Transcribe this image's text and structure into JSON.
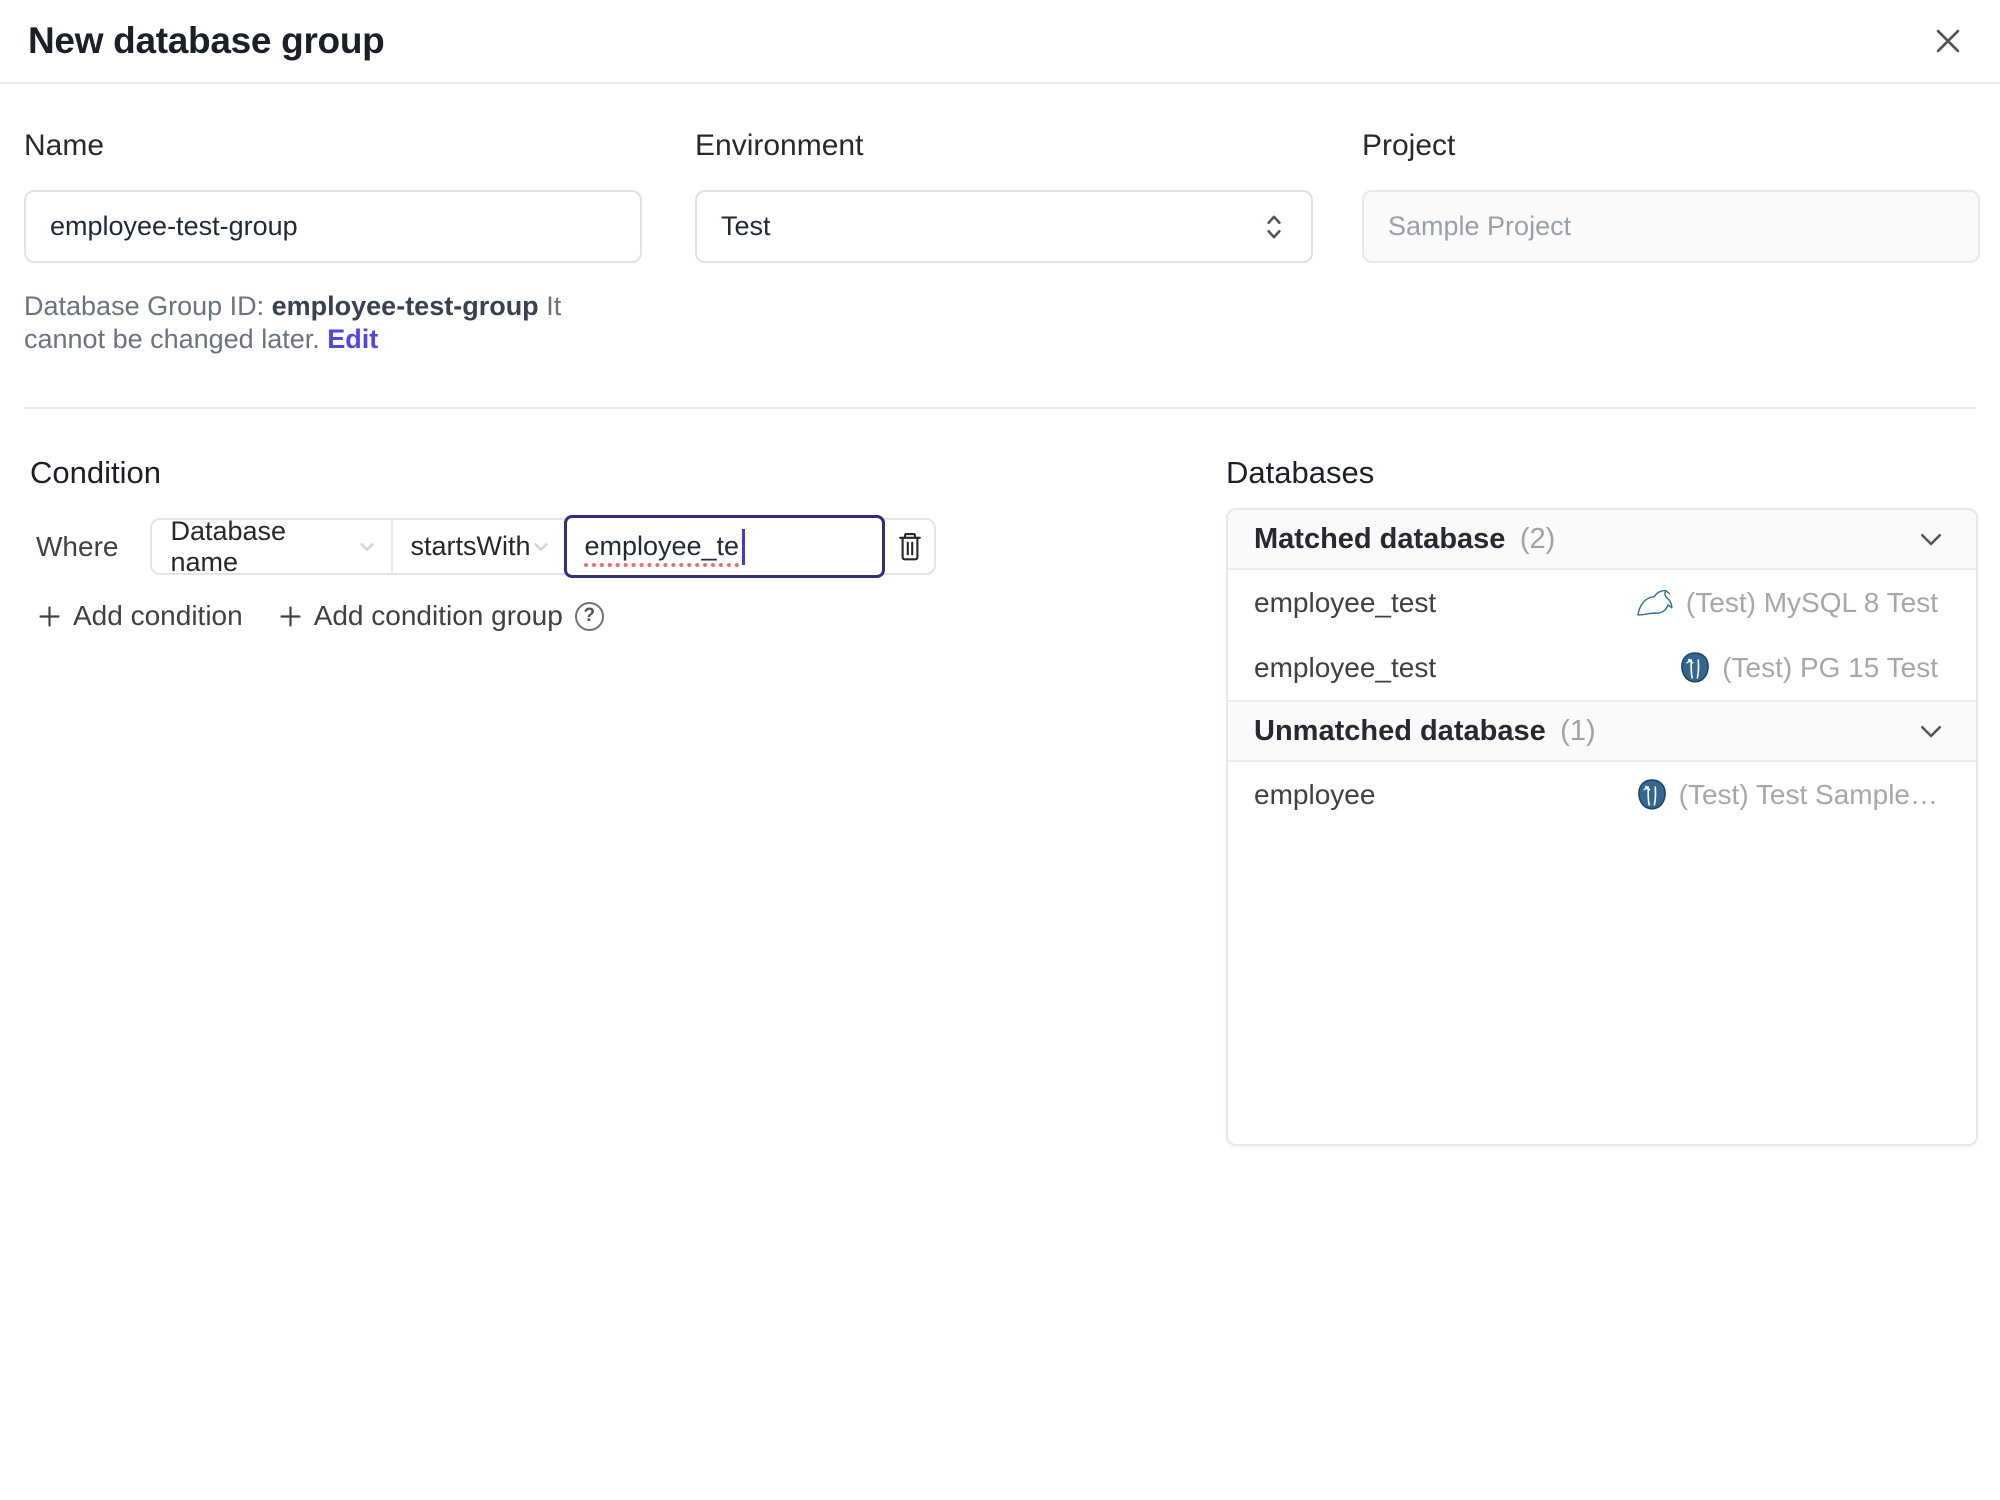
{
  "dialog": {
    "title": "New database group"
  },
  "form": {
    "name": {
      "label": "Name",
      "value": "employee-test-group"
    },
    "environment": {
      "label": "Environment",
      "value": "Test"
    },
    "project": {
      "label": "Project",
      "value": "Sample Project"
    },
    "helper": {
      "prefix": "Database Group ID: ",
      "id": "employee-test-group",
      "suffix": " It cannot be changed later. ",
      "edit_label": "Edit"
    }
  },
  "condition": {
    "heading": "Condition",
    "where_label": "Where",
    "factor": "Database name",
    "operator": "startsWith",
    "value": "employee_te",
    "add_condition_label": "Add condition",
    "add_condition_group_label": "Add condition group",
    "help_glyph": "?"
  },
  "databases": {
    "heading": "Databases",
    "matched": {
      "label": "Matched database",
      "count": "(2)",
      "rows": [
        {
          "name": "employee_test",
          "engine": "mysql",
          "instance": "(Test) MySQL 8 Test"
        },
        {
          "name": "employee_test",
          "engine": "postgresql",
          "instance": "(Test) PG 15 Test"
        }
      ]
    },
    "unmatched": {
      "label": "Unmatched database",
      "count": "(1)",
      "rows": [
        {
          "name": "employee",
          "engine": "postgresql",
          "instance": "(Test) Test Sample…"
        }
      ]
    }
  },
  "colors": {
    "accent": "#4f46e5",
    "focused_input_border": "#312e81",
    "mysql_icon": "#2e6f91",
    "postgresql_icon": "#336791",
    "spellcheck_underline": "#ef6e6e"
  }
}
